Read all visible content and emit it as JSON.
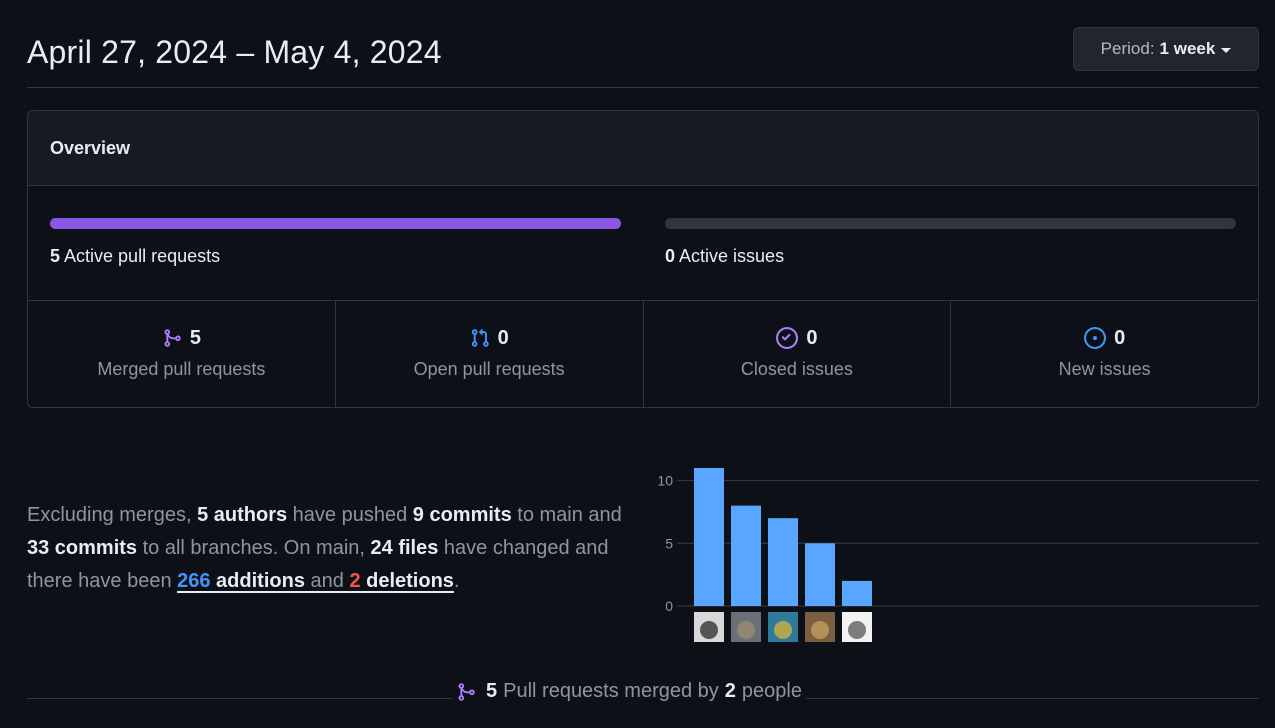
{
  "header": {
    "date_range": "April 27, 2024 – May 4, 2024",
    "period_label": "Period:",
    "period_value": "1 week"
  },
  "overview": {
    "title": "Overview",
    "active_prs": {
      "count": "5",
      "label": "Active pull requests",
      "fill_fraction": 1.0
    },
    "active_issues": {
      "count": "0",
      "label": "Active issues",
      "fill_fraction": 0.0
    },
    "stats": [
      {
        "count": "5",
        "label": "Merged pull requests",
        "icon": "git-merge-icon",
        "color": "#ab7df8"
      },
      {
        "count": "0",
        "label": "Open pull requests",
        "icon": "git-pull-request-icon",
        "color": "#4493f8"
      },
      {
        "count": "0",
        "label": "Closed issues",
        "icon": "issue-closed-icon",
        "color": "#ab7df8"
      },
      {
        "count": "0",
        "label": "New issues",
        "icon": "issue-opened-icon",
        "color": "#4493f8"
      }
    ]
  },
  "summary": {
    "t1": "Excluding merges, ",
    "authors": "5 authors",
    "t2": " have pushed ",
    "commits_main": "9 commits",
    "t3": " to main and ",
    "commits_all": "33 commits",
    "t4": " to all branches. On main, ",
    "files": "24 files",
    "t5": " have changed and there have been ",
    "additions_num": "266",
    "additions_word": " additions",
    "t6": " and ",
    "deletions_num": "2",
    "deletions_word": " deletions",
    "t7": "."
  },
  "chart_data": {
    "type": "bar",
    "categories": [
      "author-1",
      "author-2",
      "author-3",
      "author-4",
      "author-5"
    ],
    "values": [
      11,
      8,
      7,
      5,
      2
    ],
    "yticks": [
      "0",
      "5",
      "10"
    ],
    "ylim": [
      0,
      11
    ],
    "bar_color": "#58a6ff",
    "grid": true
  },
  "merged": {
    "count": "5",
    "text1": "Pull requests merged by",
    "people_count": "2",
    "text2": "people"
  }
}
